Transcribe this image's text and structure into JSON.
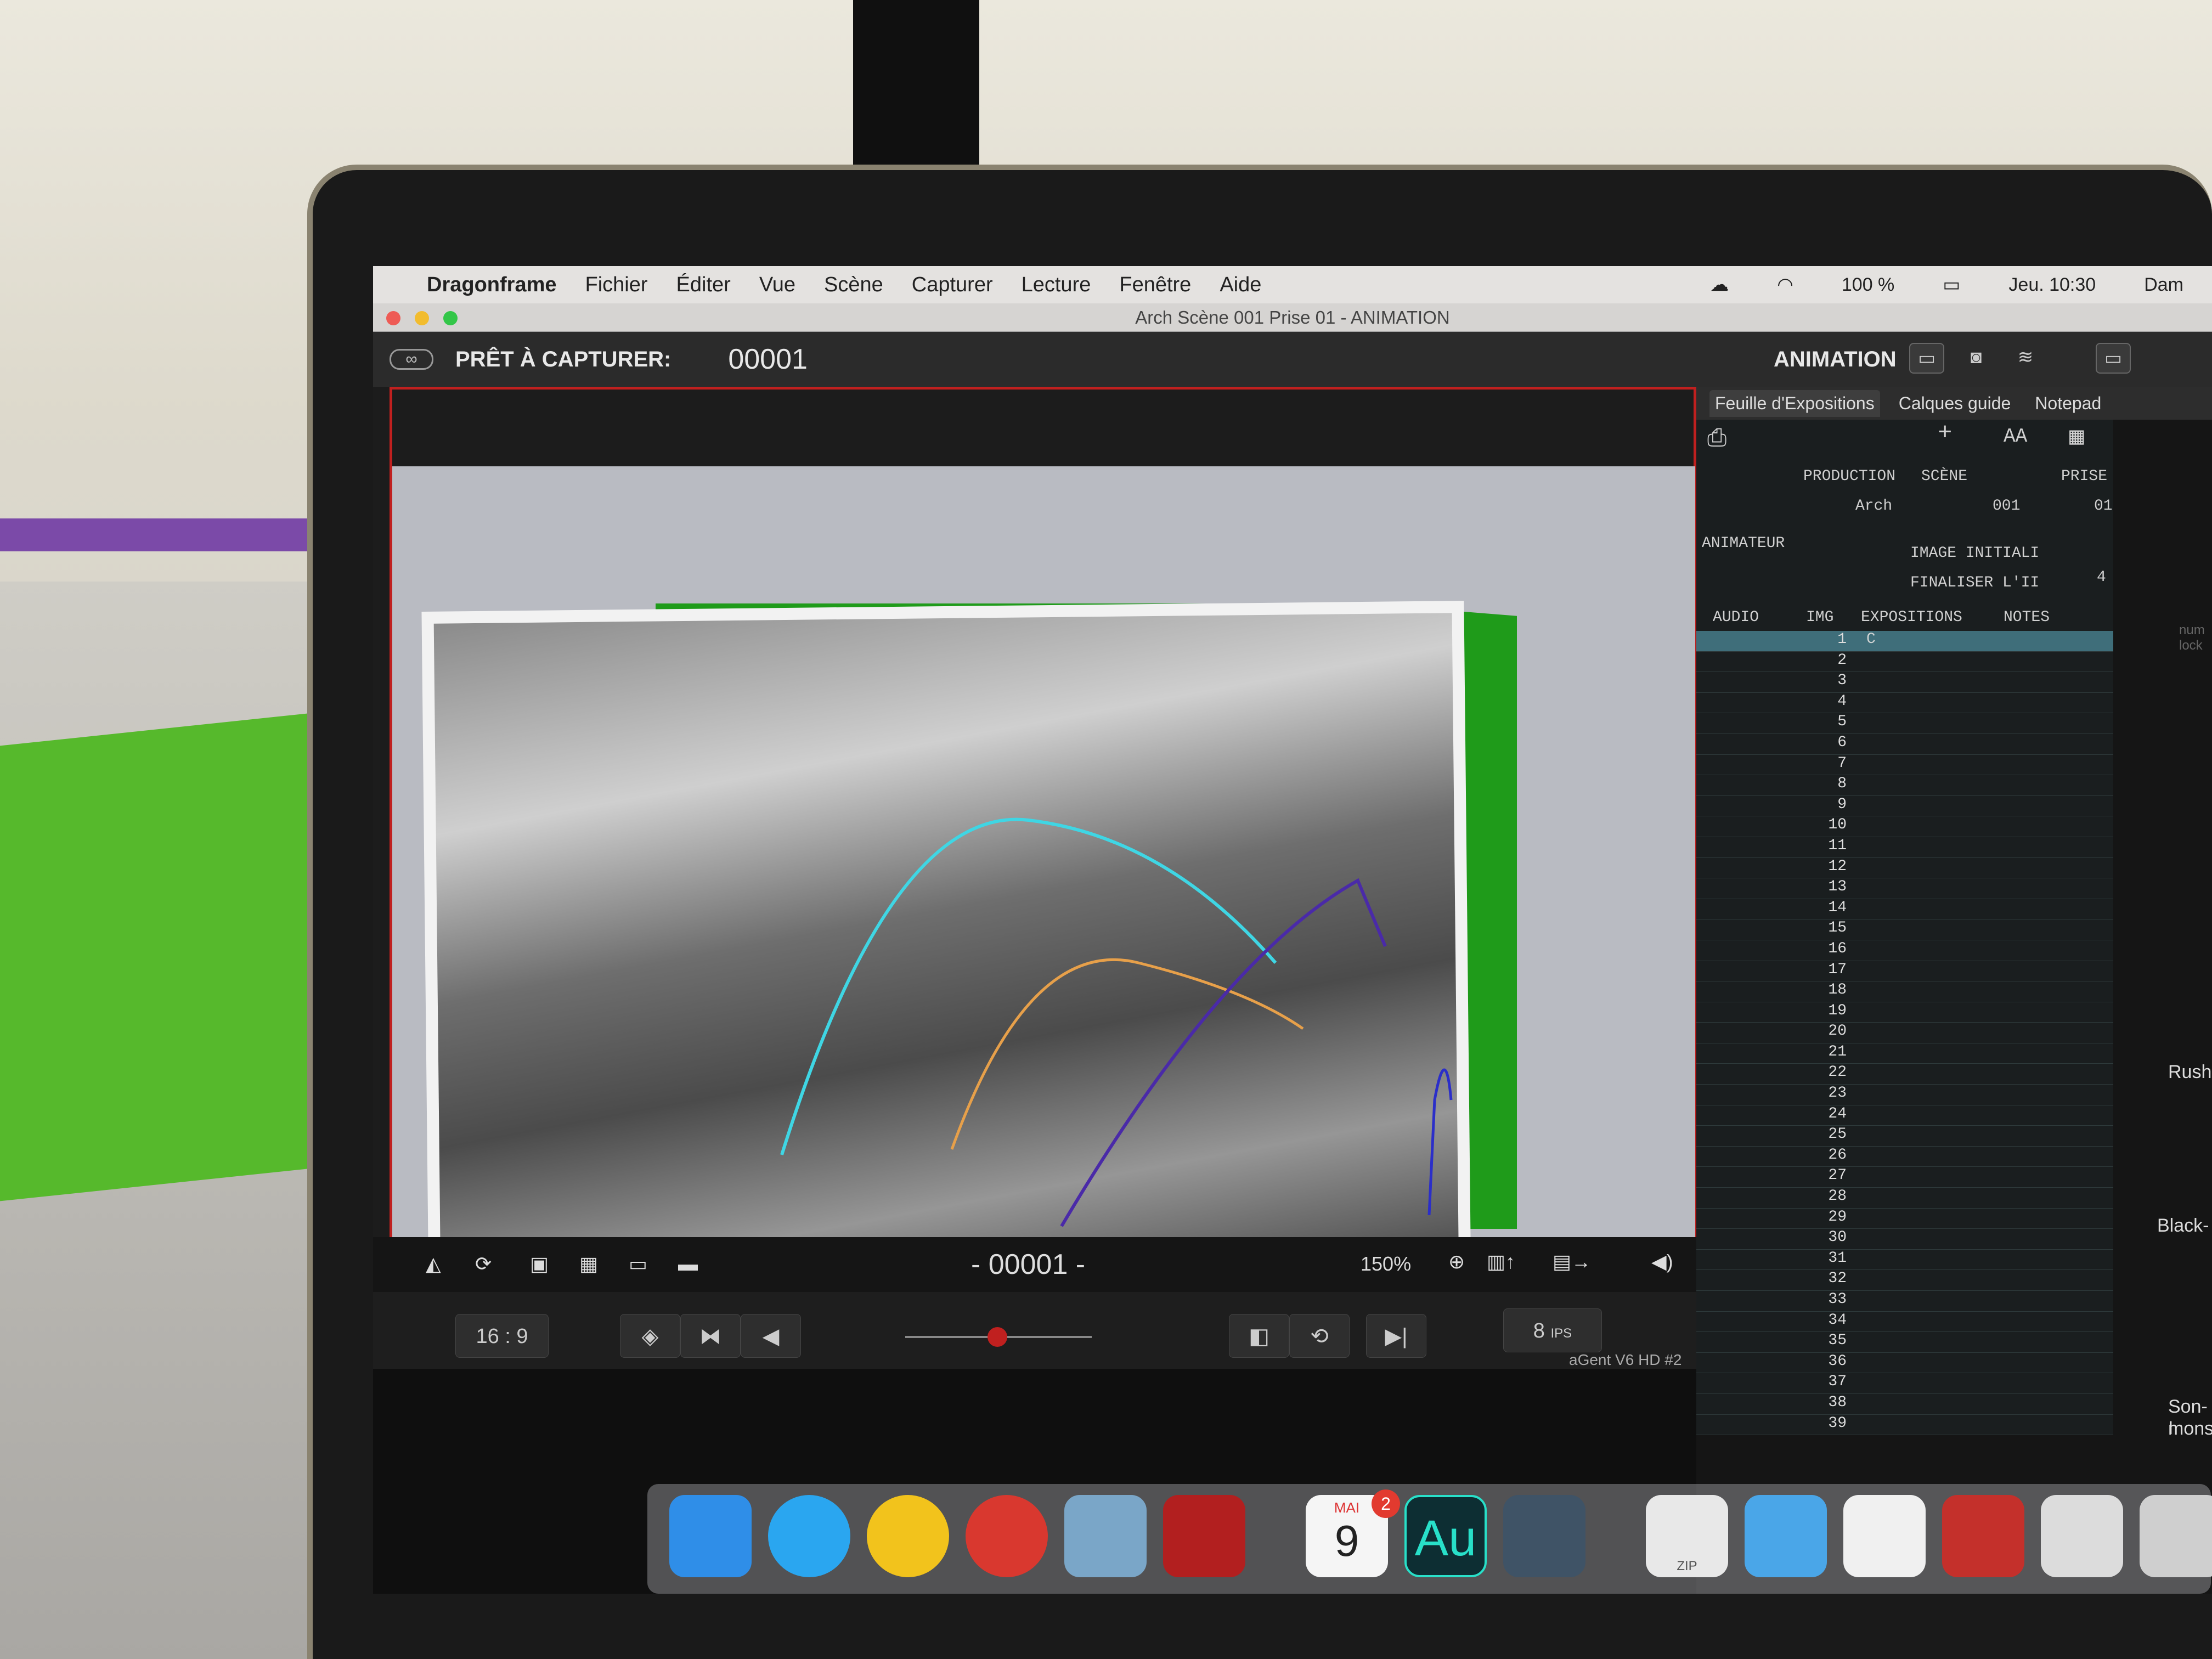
{
  "menubar": {
    "app_name": "Dragonframe",
    "items": [
      "Fichier",
      "Éditer",
      "Vue",
      "Scène",
      "Capturer",
      "Lecture",
      "Fenêtre",
      "Aide"
    ],
    "battery": "100 %",
    "clock": "Jeu. 10:30",
    "user": "Dam"
  },
  "window": {
    "title": "Arch  Scène 001  Prise 01 - ANIMATION"
  },
  "toolbar": {
    "status_label": "PRÊT À CAPTURER:",
    "frame_number": "00001",
    "mode_label": "ANIMATION"
  },
  "viewer": {
    "frame_indicator": "- 00001 -",
    "zoom": "150%",
    "aspect": "16 : 9",
    "fps_value": "8",
    "fps_unit": "IPS",
    "camera_name": "aGent V6 HD #2"
  },
  "side_panel": {
    "tabs": [
      "Feuille d'Expositions",
      "Calques guide",
      "Notepad"
    ],
    "font_size_label": "AA",
    "labels": {
      "production": "PRODUCTION",
      "scene": "SCÈNE",
      "prise": "PRISE",
      "animateur": "ANIMATEUR",
      "image_initiale": "IMAGE INITIALI",
      "finaliser": "FINALISER L'II",
      "finaliser_value": "4",
      "production_value": "Arch",
      "scene_value": "001",
      "prise_value": "01"
    },
    "columns": [
      "AUDIO",
      "IMG",
      "EXPOSITIONS",
      "NOTES"
    ],
    "first_row_exposition": "C",
    "row_numbers": [
      "1",
      "2",
      "3",
      "4",
      "5",
      "6",
      "7",
      "8",
      "9",
      "10",
      "11",
      "12",
      "13",
      "14",
      "15",
      "16",
      "17",
      "18",
      "19",
      "20",
      "21",
      "22",
      "23",
      "24",
      "25",
      "26",
      "27",
      "28",
      "29",
      "30",
      "31",
      "32",
      "33",
      "34",
      "35",
      "36",
      "37",
      "38",
      "39"
    ]
  },
  "right_edge": {
    "rush_label": "Rush",
    "black_label": "Black-",
    "son_label": "Son-I",
    "mons_label": "mons",
    "num_lock": "num lock"
  },
  "dock": {
    "calendar_month": "MAI",
    "calendar_day": "9",
    "calendar_badge": "2",
    "audition_label": "Au",
    "zip_label": "ZIP"
  }
}
